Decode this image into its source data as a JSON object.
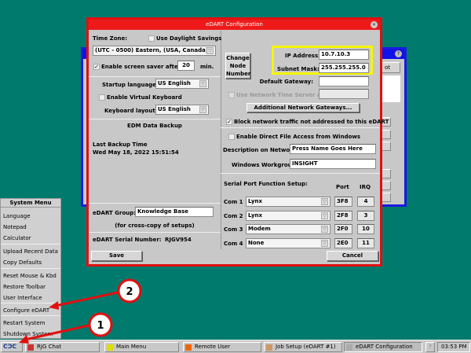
{
  "background_window": {
    "button_partial": "ot"
  },
  "dialog": {
    "title": "eDART Configuration",
    "time_zone_label": "Time Zone:",
    "daylight_label": "Use Daylight Savings",
    "daylight_checked": false,
    "time_zone_value": "(UTC - 0500) Eastern, (USA, Canada)",
    "screen_saver_label": "Enable screen saver after",
    "screen_saver_checked": true,
    "screen_saver_minutes": "20",
    "min_label": "min.",
    "startup_language_label": "Startup language:",
    "startup_language_value": "US English",
    "virtual_keyboard_label": "Enable Virtual Keyboard",
    "virtual_keyboard_checked": false,
    "keyboard_layout_label": "Keyboard layout:",
    "keyboard_layout_value": "US English",
    "backup_heading": "EDM Data Backup",
    "last_backup_label": "Last Backup Time",
    "last_backup_value": "Wed May 18, 2022 15:51:54",
    "group_label": "eDART Group:",
    "group_value": "Knowledge Base",
    "group_note": "(for cross-copy of setups)",
    "serial_label": "eDART Serial Number:",
    "serial_value": "RJGV954",
    "change_node_button": "Change Node Number",
    "ip_label": "IP Address:",
    "ip_value": "10.7.10.3",
    "subnet_label": "Subnet Mask:",
    "subnet_value": "255.255.255.0",
    "gateway_label": "Default Gateway:",
    "gateway_value": "",
    "nts_label": "Use Network Time Server at",
    "nts_value": "",
    "additional_gateways_button": "Additional Network Gateways...",
    "block_traffic_label": "Block network traffic not addressed to this eDART",
    "block_traffic_checked": true,
    "direct_file_label": "Enable Direct File Access from Windows",
    "direct_file_checked": false,
    "description_label": "Description on Network:",
    "description_value": "Press Name Goes Here",
    "workgroup_label": "Windows Workgroup:",
    "workgroup_value": "INSIGHT",
    "serial_setup_heading": "Serial Port Function Setup:",
    "port_header": "Port",
    "irq_header": "IRQ",
    "com_ports": [
      {
        "label": "Com 1",
        "function": "Lynx",
        "port": "3F8",
        "irq": "4"
      },
      {
        "label": "Com 2",
        "function": "Lynx",
        "port": "2F8",
        "irq": "3"
      },
      {
        "label": "Com 3",
        "function": "Modem",
        "port": "2F0",
        "irq": "10"
      },
      {
        "label": "Com 4",
        "function": "None",
        "port": "2E0",
        "irq": "11"
      }
    ],
    "save_button": "Save",
    "cancel_button": "Cancel"
  },
  "system_menu": {
    "title": "System Menu",
    "items": [
      "Language",
      "Notepad",
      "Calculator",
      "Upload Recent Data",
      "Copy Defaults",
      "Reset Mouse & Kbd",
      "Restore Toolbar",
      "User Interface",
      "Configure eDART",
      "Restart System",
      "Shutdown System"
    ]
  },
  "annotations": {
    "step1": "1",
    "step2": "2",
    "highlight_color": "#f5f500",
    "arrow_color": "#e01010"
  },
  "taskbar": {
    "tasks": [
      "RJG Chat",
      "Main Menu",
      "Remote User",
      "Job Setup (eDART #1)",
      "eDART Configuration"
    ],
    "help": "?",
    "clock": "03:53 PM"
  }
}
